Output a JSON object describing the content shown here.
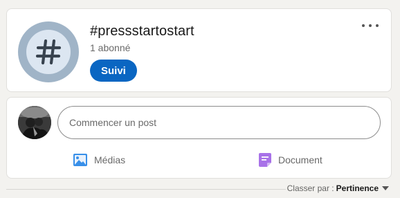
{
  "hashtag": {
    "avatar_icon": "hashtag-icon",
    "title": "#pressstartostart",
    "followers": "1 abonné",
    "follow_button_label": "Suivi",
    "more_icon": "more-horizontal-icon"
  },
  "share_box": {
    "input_placeholder": "Commencer un post",
    "actions": [
      {
        "label": "Médias",
        "icon": "image-icon",
        "icon_color": "#378fe9"
      },
      {
        "label": "Document",
        "icon": "document-icon",
        "icon_color": "#a872e8"
      }
    ]
  },
  "sort": {
    "label": "Classer par :",
    "value": "Pertinence",
    "icon": "caret-down-icon"
  },
  "colors": {
    "accent": "#0a66c2",
    "page_background": "#f3f2ef",
    "card_background": "#ffffff"
  }
}
